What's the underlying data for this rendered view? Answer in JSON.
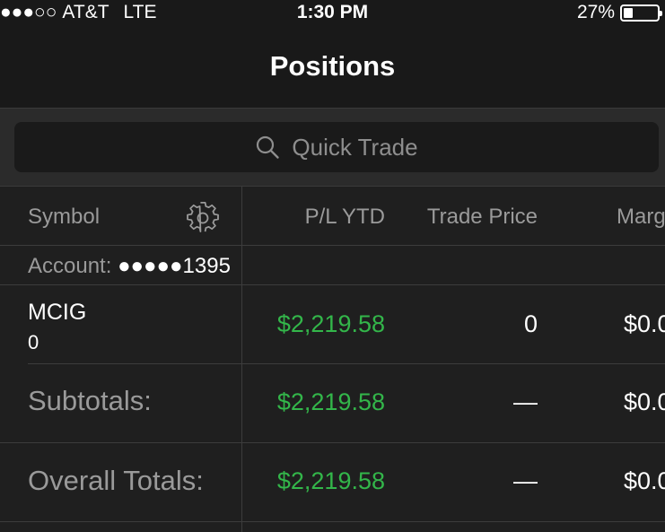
{
  "status_bar": {
    "signal": "●●●○○",
    "carrier": "AT&T",
    "network": "LTE",
    "time": "1:30 PM",
    "battery_percent": "27%",
    "battery_level": 0.27
  },
  "nav": {
    "title": "Positions"
  },
  "search": {
    "placeholder": "Quick Trade"
  },
  "table": {
    "columns": {
      "symbol": "Symbol",
      "pl_ytd": "P/L YTD",
      "trade_price": "Trade Price",
      "margin": "Marg"
    },
    "account": {
      "label": "Account:",
      "masked": "●●●●●",
      "number": "1395"
    },
    "position": {
      "symbol": "MCIG",
      "quantity": "0",
      "pl_ytd": "$2,219.58",
      "trade_price": "0",
      "margin": "$0.0"
    },
    "subtotals": {
      "label": "Subtotals:",
      "pl_ytd": "$2,219.58",
      "trade_price": "—",
      "margin": "$0.0"
    },
    "overall_totals": {
      "label": "Overall Totals:",
      "pl_ytd": "$2,219.58",
      "trade_price": "—",
      "margin": "$0.0"
    }
  },
  "colors": {
    "gain": "#33b64a",
    "background": "#1f1f1f",
    "bar": "#191919"
  }
}
